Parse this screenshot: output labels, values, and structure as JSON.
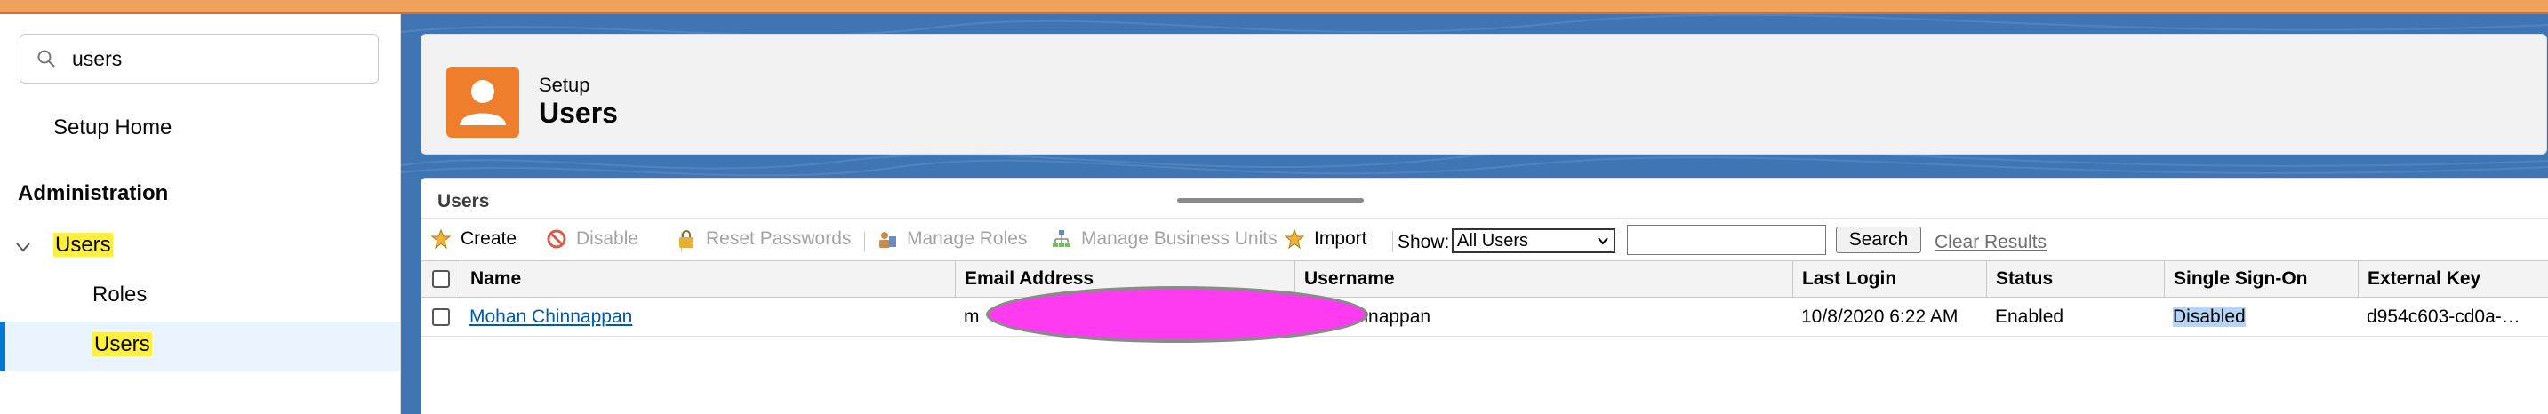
{
  "sidebar": {
    "search_value": "users",
    "setup_home": "Setup Home",
    "section_heading": "Administration",
    "users_group": "Users",
    "items": [
      {
        "label": "Roles"
      },
      {
        "label": "Users"
      }
    ]
  },
  "header": {
    "kicker": "Setup",
    "title": "Users"
  },
  "panel": {
    "title": "Users",
    "toolbar": {
      "create": "Create",
      "disable": "Disable",
      "reset_passwords": "Reset Passwords",
      "manage_roles": "Manage Roles",
      "manage_business_units": "Manage Business Units",
      "import": "Import",
      "show_label": "Show:",
      "show_value": "All Users",
      "search_button": "Search",
      "clear_results": "Clear Results",
      "filter_value": ""
    },
    "columns": [
      "Name",
      "Email Address",
      "Username",
      "Last Login",
      "Status",
      "Single Sign-On",
      "External Key"
    ],
    "rows": [
      {
        "name": "Mohan Chinnappan",
        "email_fragment": "m",
        "username_fragment": "hinnappan",
        "last_login": "10/8/2020 6:22 AM",
        "status": "Enabled",
        "sso": "Disabled",
        "external_key": "d954c603-cd0a-…"
      }
    ]
  },
  "colors": {
    "accent_orange": "#ef7e2c",
    "background_blue": "#3f74b5",
    "highlight_yellow": "#fff03f",
    "redaction_magenta": "#ff3bf1"
  }
}
